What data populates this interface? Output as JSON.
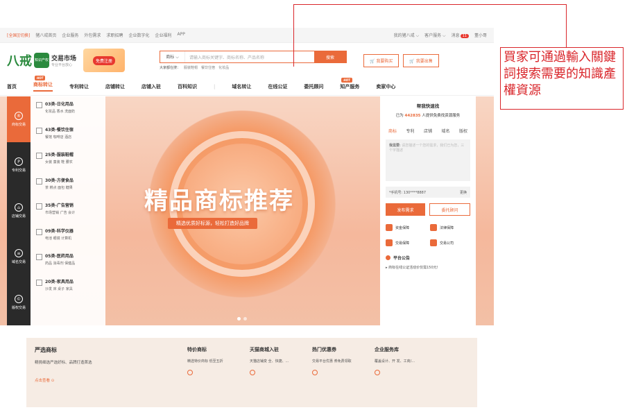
{
  "topbar": {
    "city": "[全国][切换]",
    "links": [
      "猪八戒首页",
      "企业服务",
      "外包需求",
      "求职招聘",
      "企业数字化",
      "企业福利",
      "APP"
    ],
    "right": [
      "我的猪八戒 ⌵",
      "客户服务 ⌵",
      "消息",
      "董小哥"
    ],
    "msg_count": "11"
  },
  "header": {
    "logo_mark": "八戒",
    "logo_badge": "知识产权",
    "logo_title": "交易市场",
    "logo_sub": "专业平台放心",
    "logo_url": "ipr.zbj.com",
    "promo": "免费注册",
    "search_cat": "商标 ⌵",
    "search_placeholder": "请输入商标关键字、商标名称、产品名称",
    "search_btn": "搜索",
    "hot_label": "大家都在搜：",
    "hot_items": [
      "服装鞋帽",
      "餐饮住宿",
      "化妆品"
    ],
    "buy_btn": "我要购买",
    "sell_btn": "我要出售"
  },
  "nav": {
    "items": [
      "首页",
      "商标转让",
      "专利转让",
      "店铺转让",
      "店铺入驻",
      "百科知识",
      "|",
      "域名转让",
      "在线公证",
      "委托顾问",
      "知产服务",
      "卖家中心"
    ],
    "hot": "HOT"
  },
  "sidebar": [
    "商标交易",
    "专利交易",
    "店铺交易",
    "域名交易",
    "版权交易"
  ],
  "categories": [
    {
      "title": "03类-日化用品",
      "sub": "化妆品 香水 洗面奶"
    },
    {
      "title": "43类-餐饮住宿",
      "sub": "餐馆 咖啡店 酒店"
    },
    {
      "title": "25类-服装鞋帽",
      "sub": "女装 童装 鞋 腰农"
    },
    {
      "title": "30类-方便食品",
      "sub": "茶 糕点 面包 糖果"
    },
    {
      "title": "35类-广告营销",
      "sub": "市场营销 广告 会计"
    },
    {
      "title": "09类-科学仪器",
      "sub": "电池 眼镜 计算机"
    },
    {
      "title": "05类-医药用品",
      "sub": "药品 消毒剂 保健品"
    },
    {
      "title": "20类-家具用品",
      "sub": "沙发 床 桌子 家具"
    }
  ],
  "banner": {
    "title": "精品商标推荐",
    "subtitle": "精选优质好标源，轻松打造好品牌"
  },
  "rpanel": {
    "title": "帮我快速找",
    "sub_pre": "已为",
    "sub_num": "442835",
    "sub_post": "人提供免费找资源服务",
    "tabs": [
      "商标",
      "专利",
      "店铺",
      "域名",
      "版权"
    ],
    "text_label": "我需要:",
    "text_hint": "请您描述一个您的需求，我们已为您，三个字描述",
    "phone": "*手机号: 130****8887",
    "change": "更换",
    "btn1": "发布需求",
    "btn2": "委托顾问",
    "guarantees": [
      "资金保障",
      "法律保障",
      "交易保障",
      "交易公司"
    ],
    "notice_title": "平台公告",
    "notice_text": "▸  商标在线公证活动价仅需150元!"
  },
  "cards": {
    "main_title": "严选商标",
    "main_desc": "精挑细选严选好标、品牌打造首选",
    "main_link": "点击查看",
    "others": [
      {
        "title": "特价商标",
        "desc": "精选特价商标 低至五折"
      },
      {
        "title": "天猫商城入驻",
        "desc": "天猫店铺变 全、快捷、..."
      },
      {
        "title": "热门优惠券",
        "desc": "交易平台优惠 券免费领取"
      },
      {
        "title": "企业服务库",
        "desc": "覆盖设计、开 发、工商/..."
      }
    ]
  },
  "annotation": {
    "text": "買家可通過輸入關鍵詞搜索需要的知識產權資源"
  },
  "colors": {
    "accent": "#ea6a3a",
    "annotation": "#d9252a",
    "sidebar": "#2a2a2a"
  }
}
